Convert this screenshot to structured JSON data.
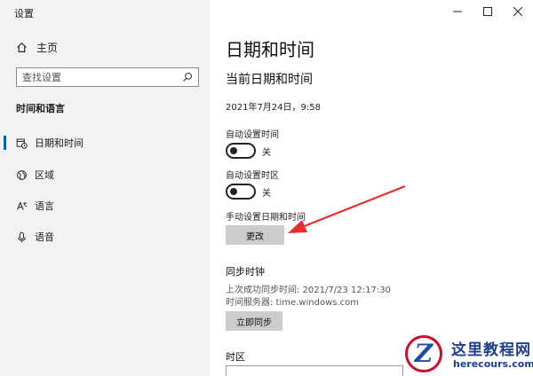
{
  "window": {
    "title": "设置",
    "controls": {
      "minimize": "minimize",
      "maximize": "maximize",
      "close": "close"
    }
  },
  "sidebar": {
    "home_label": "主页",
    "search_placeholder": "查找设置",
    "section_title": "时间和语言",
    "items": [
      {
        "label": "日期和时间",
        "icon": "calendar-clock-icon",
        "active": true
      },
      {
        "label": "区域",
        "icon": "globe-region-icon",
        "active": false
      },
      {
        "label": "语言",
        "icon": "language-icon",
        "active": false
      },
      {
        "label": "语音",
        "icon": "microphone-icon",
        "active": false
      }
    ]
  },
  "main": {
    "title": "日期和时间",
    "current_section": "当前日期和时间",
    "current_datetime": "2021年7月24日，9:58",
    "auto_time": {
      "label": "自动设置时间",
      "state": "关"
    },
    "auto_timezone": {
      "label": "自动设置时区",
      "state": "关"
    },
    "manual": {
      "label": "手动设置日期和时间",
      "button": "更改"
    },
    "sync": {
      "title": "同步时钟",
      "last_sync": "上次成功同步时间: 2021/7/23 12:17:30",
      "server": "时间服务器: time.windows.com",
      "button": "立即同步"
    },
    "timezone": {
      "label": "时区"
    }
  },
  "watermark": {
    "logo_letter": "Z",
    "name": "这里教程网",
    "url": "herecours.com"
  },
  "colors": {
    "accent": "#0063b1",
    "annotation": "#e3312f",
    "sidebar_bg": "#f2f2f2",
    "button_bg": "#cccccc"
  }
}
